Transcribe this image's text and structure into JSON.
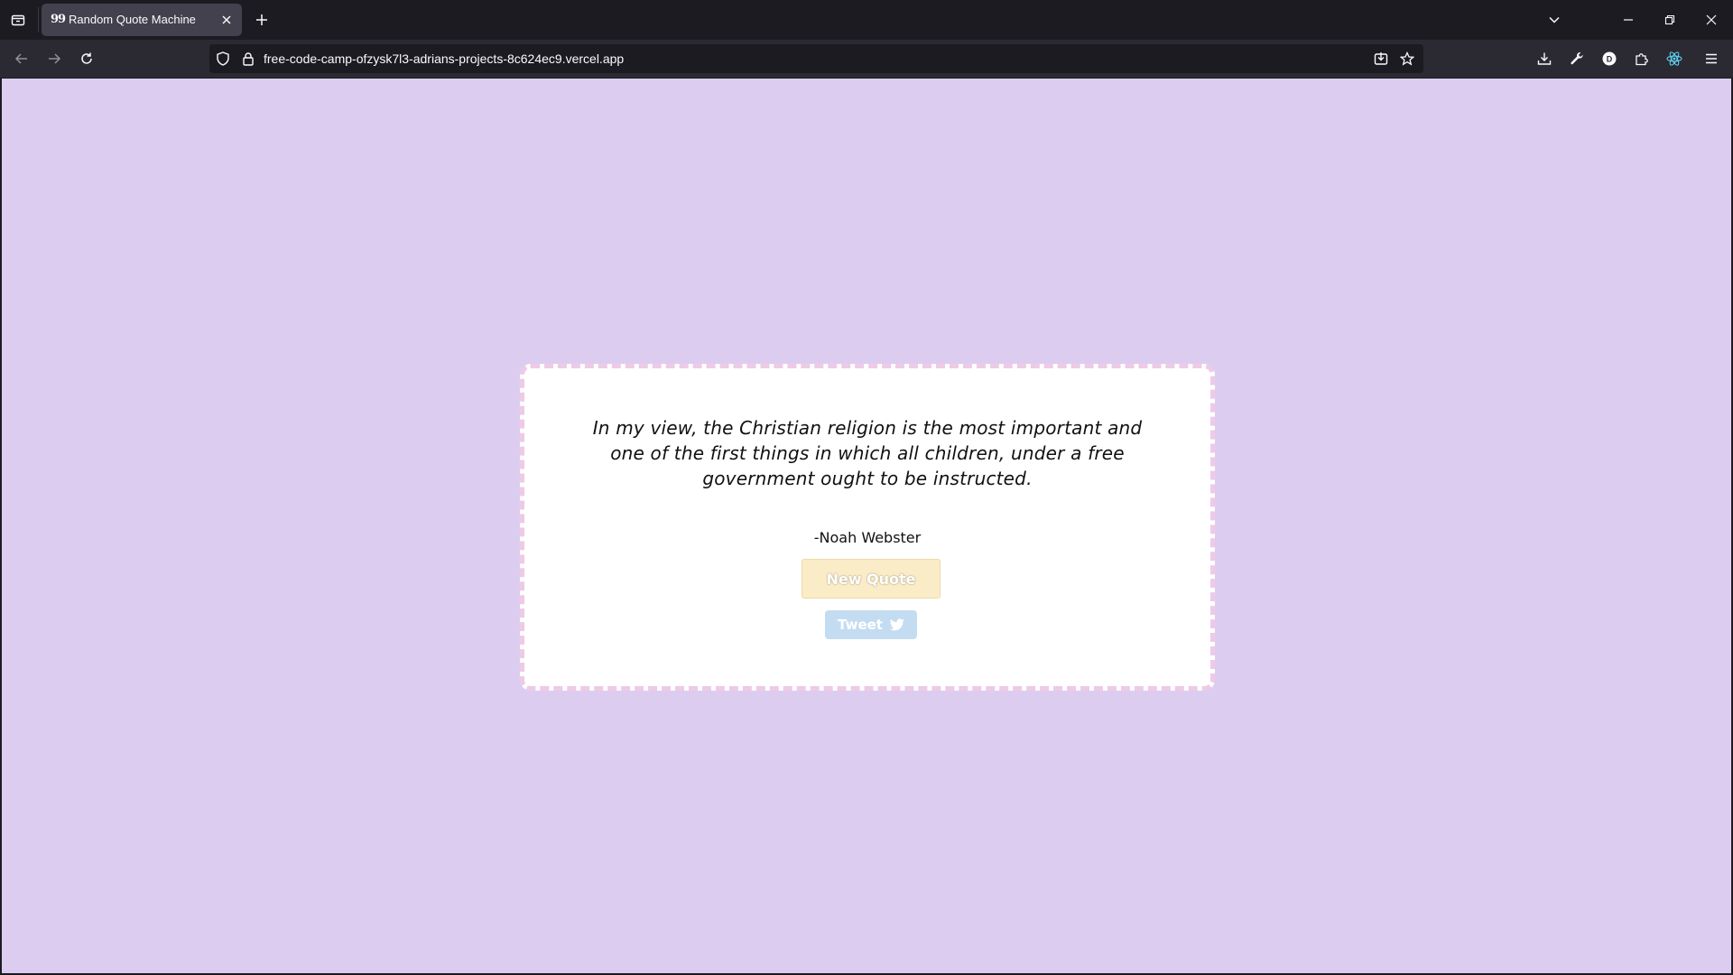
{
  "browser": {
    "tab": {
      "favicon": "99",
      "title": "Random Quote Machine"
    },
    "url": "free-code-camp-ofzysk7l3-adrians-projects-8c624ec9.vercel.app",
    "icons": {
      "tab_list": "tab-list-icon",
      "new_tab": "plus-icon",
      "close_tab": "close-icon",
      "back": "arrow-left-icon",
      "forward": "arrow-right-icon",
      "reload": "reload-icon",
      "shield": "shield-icon",
      "lock": "lock-icon",
      "install": "install-icon",
      "bookmark": "star-icon",
      "downloads": "download-icon",
      "devtools": "wrench-icon",
      "profile": "profile-icon",
      "extensions": "puzzle-icon",
      "react": "react-icon",
      "menu": "hamburger-menu-icon"
    }
  },
  "app": {
    "quote": "In my view, the Christian religion is the most important and one of the first things in which all children, under a free government ought to be instructed.",
    "author": "-Noah Webster",
    "new_quote_label": "New Quote",
    "tweet_label": "Tweet"
  },
  "colors": {
    "page_background": "#dccdf0",
    "card_border": "#eecae6",
    "new_quote_button": "#fbecc8",
    "tweet_button": "#c4dcf1"
  }
}
